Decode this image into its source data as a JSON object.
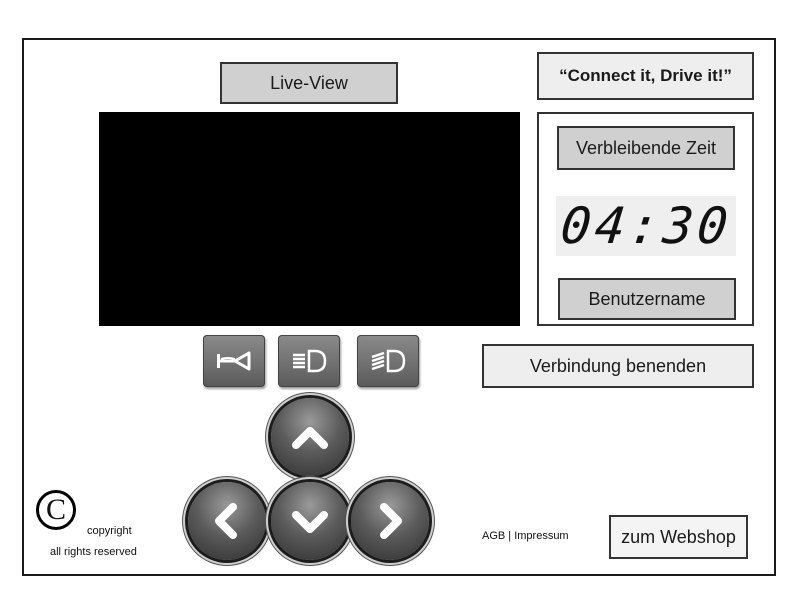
{
  "live_view": {
    "label": "Live-View"
  },
  "slogan": "“Connect it, Drive it!”",
  "timer": {
    "label": "Verbleibende Zeit",
    "value": "04:30"
  },
  "user": {
    "label": "Benutzername"
  },
  "disconnect_label": "Verbindung benenden",
  "controls": {
    "functions": [
      "horn-icon",
      "low-beam-icon",
      "high-beam-icon"
    ],
    "arrows": [
      "chevron-up-icon",
      "chevron-left-icon",
      "chevron-down-icon",
      "chevron-right-icon"
    ]
  },
  "footer": {
    "copyright_symbol": "C",
    "copyright": "copyright",
    "rights": "all rights reserved",
    "links": "AGB | Impressum",
    "webshop_label": "zum Webshop"
  }
}
